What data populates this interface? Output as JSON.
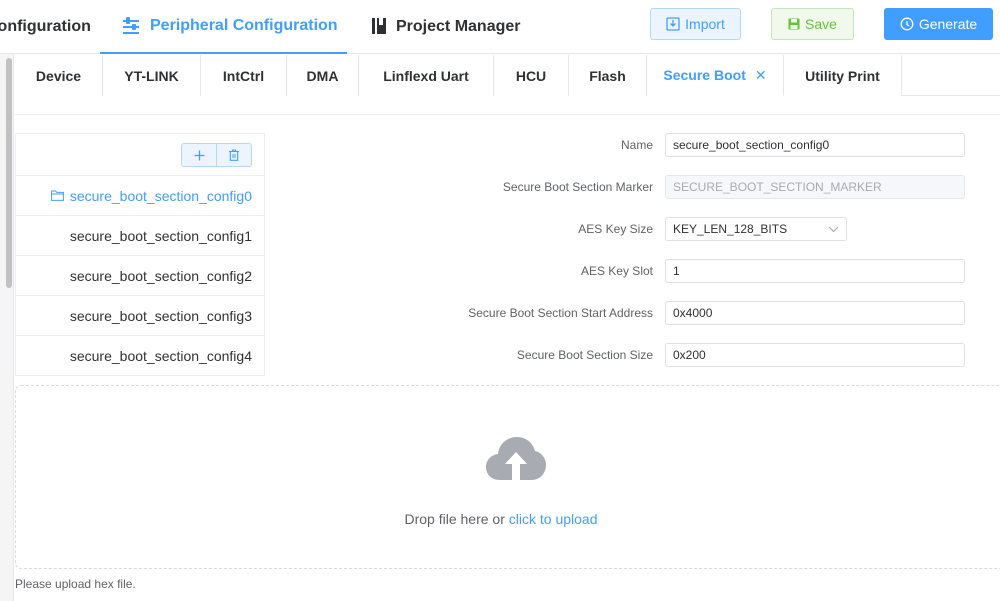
{
  "top_nav": {
    "configuration": "Configuration",
    "peripheral": "Peripheral Configuration",
    "project": "Project Manager"
  },
  "actions": {
    "import": "Import",
    "save": "Save",
    "generate": "Generate"
  },
  "tabs": [
    "Device",
    "YT-LINK",
    "IntCtrl",
    "DMA",
    "Linflexd Uart",
    "HCU",
    "Flash",
    "Secure Boot",
    "Utility Print"
  ],
  "active_tab": "Secure Boot",
  "sections": [
    "secure_boot_section_config0",
    "secure_boot_section_config1",
    "secure_boot_section_config2",
    "secure_boot_section_config3",
    "secure_boot_section_config4"
  ],
  "form": {
    "name_label": "Name",
    "name_value": "secure_boot_section_config0",
    "marker_label": "Secure Boot Section Marker",
    "marker_value": "SECURE_BOOT_SECTION_MARKER",
    "keysize_label": "AES Key Size",
    "keysize_value": "KEY_LEN_128_BITS",
    "keyslot_label": "AES Key Slot",
    "keyslot_value": "1",
    "start_label": "Secure Boot Section Start Address",
    "start_value": "0x4000",
    "size_label": "Secure Boot Section Size",
    "size_value": "0x200"
  },
  "upload": {
    "drop_text": "Drop file here or",
    "click_text": "click to upload",
    "tip": "Please upload hex file."
  },
  "colors": {
    "primary": "#409eff",
    "success": "#67c23a",
    "border": "#dcdfe6"
  }
}
